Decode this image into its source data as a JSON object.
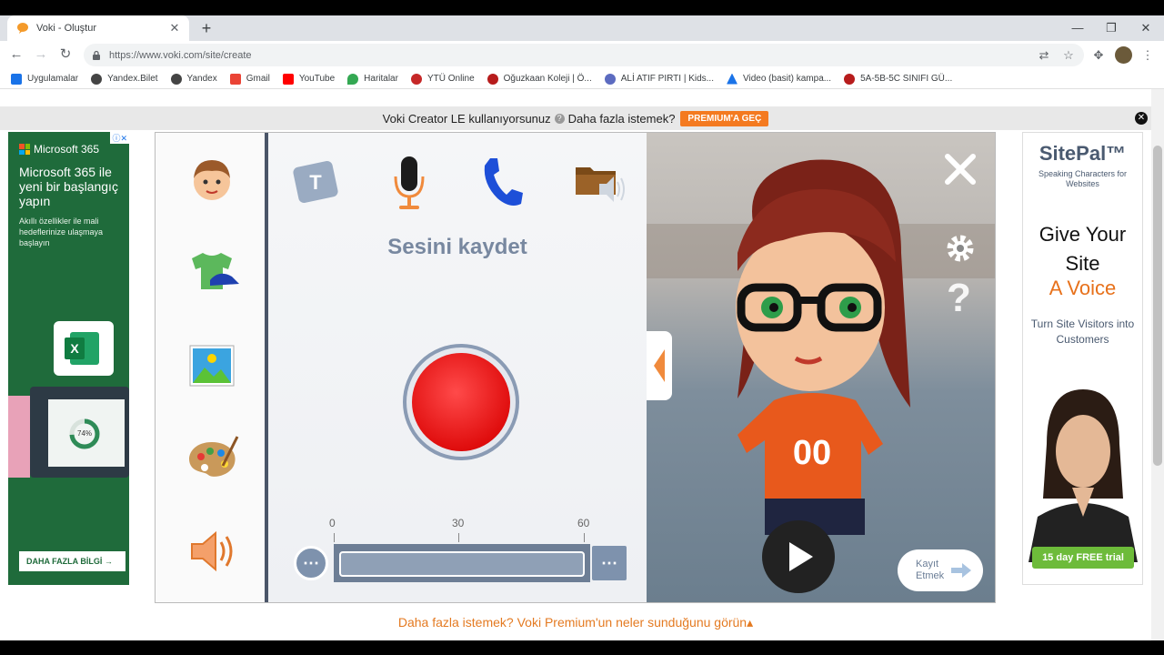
{
  "browser": {
    "tab_title": "Voki - Oluştur",
    "url": "https://www.voki.com/site/create",
    "bookmarks": [
      {
        "label": "Uygulamalar",
        "color": "#5f6368"
      },
      {
        "label": "Yandex.Bilet",
        "color": "#444444"
      },
      {
        "label": "Yandex",
        "color": "#444444"
      },
      {
        "label": "Gmail",
        "color": "#ea4335"
      },
      {
        "label": "YouTube",
        "color": "#ff0000"
      },
      {
        "label": "Haritalar",
        "color": "#34a853"
      },
      {
        "label": "YTÜ Online",
        "color": "#c62828"
      },
      {
        "label": "Oğuzkaan Koleji | Ö...",
        "color": "#b71c1c"
      },
      {
        "label": "ALİ ATIF PIRTI | Kids...",
        "color": "#5c6bc0"
      },
      {
        "label": "Video (basit) kampa...",
        "color": "#1a73e8"
      },
      {
        "label": "5A-5B-5C SINIFI GÜ...",
        "color": "#b71c1c"
      }
    ]
  },
  "banner": {
    "text": "Voki Creator LE kullanıyorsunuz",
    "more": "Daha fazla istemek?",
    "premium": "PREMIUM'A GEÇ"
  },
  "ad_left": {
    "brand": "Microsoft 365",
    "headline": "Microsoft 365 ile yeni bir başlangıç yapın",
    "sub": "Akıllı özellikler ile mali hedeflerinize ulaşmaya başlayın",
    "progress_label": "74%",
    "cta": "DAHA FAZLA BİLGİ →"
  },
  "ad_right": {
    "brand": "SitePal™",
    "tagline": "Speaking Characters for Websites",
    "headline": "Give Your Site",
    "headline_accent": "A Voice",
    "text": "Turn Site Visitors into Customers",
    "trial": "15 day FREE trial"
  },
  "voki": {
    "panel_title": "Sesini kaydet",
    "ticks": [
      "0",
      "30",
      "60"
    ],
    "save_label_1": "Kayıt",
    "save_label_2": "Etmek",
    "player_number": "00"
  },
  "footer": {
    "link": "Daha fazla istemek? Voki Premium'un neler sunduğunu görün▴"
  },
  "colors": {
    "accent": "#f47a20",
    "record": "#e00e0e",
    "panel_blue": "#7e92ad"
  }
}
